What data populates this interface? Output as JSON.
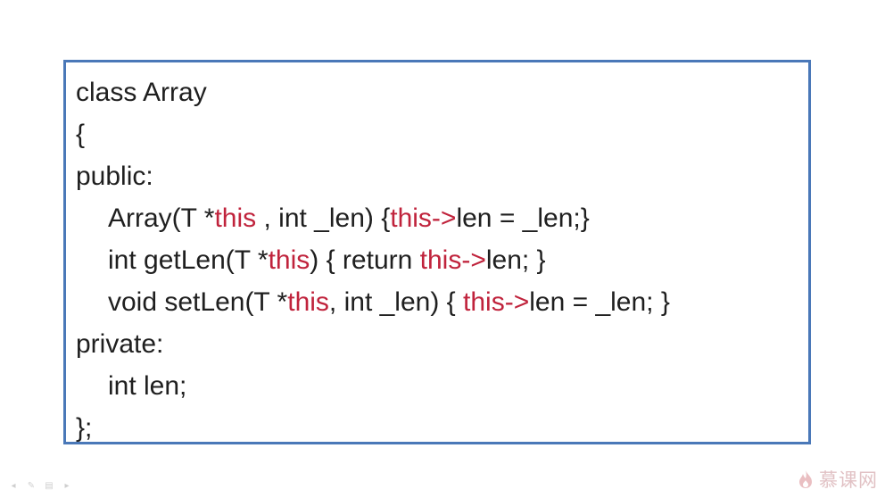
{
  "code": {
    "lines": [
      {
        "indent": false,
        "parts": [
          {
            "t": "class Array",
            "kw": false
          }
        ]
      },
      {
        "indent": false,
        "parts": [
          {
            "t": "{",
            "kw": false
          }
        ]
      },
      {
        "indent": false,
        "parts": [
          {
            "t": "public:",
            "kw": false
          }
        ]
      },
      {
        "indent": true,
        "parts": [
          {
            "t": "Array(T *",
            "kw": false
          },
          {
            "t": "this",
            "kw": true
          },
          {
            "t": " , int _len) {",
            "kw": false
          },
          {
            "t": "this->",
            "kw": true
          },
          {
            "t": "len = _len;}",
            "kw": false
          }
        ]
      },
      {
        "indent": true,
        "parts": [
          {
            "t": "int getLen(T *",
            "kw": false
          },
          {
            "t": "this",
            "kw": true
          },
          {
            "t": ") { return ",
            "kw": false
          },
          {
            "t": "this->",
            "kw": true
          },
          {
            "t": "len; }",
            "kw": false
          }
        ]
      },
      {
        "indent": true,
        "parts": [
          {
            "t": "void setLen(T *",
            "kw": false
          },
          {
            "t": "this",
            "kw": true
          },
          {
            "t": ", int _len) { ",
            "kw": false
          },
          {
            "t": "this->",
            "kw": true
          },
          {
            "t": "len = _len; }",
            "kw": false
          }
        ]
      },
      {
        "indent": false,
        "parts": [
          {
            "t": "private:",
            "kw": false
          }
        ]
      },
      {
        "indent": true,
        "parts": [
          {
            "t": "int len;",
            "kw": false
          }
        ]
      },
      {
        "indent": false,
        "parts": [
          {
            "t": "};",
            "kw": false
          }
        ]
      }
    ],
    "keyword_color": "#c0233c",
    "border_color": "#4a78b8"
  },
  "toolbar": {
    "icons": [
      "prev-arrow-icon",
      "pen-icon",
      "slide-menu-icon",
      "next-arrow-icon"
    ]
  },
  "watermark": {
    "text": "慕课网",
    "logo": "flame-logo-icon"
  }
}
